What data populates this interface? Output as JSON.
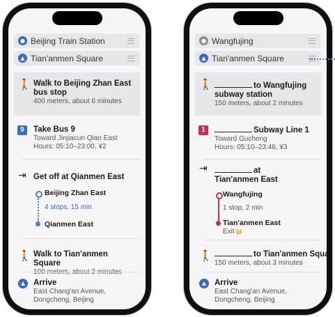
{
  "left": {
    "origin": "Beijing Train Station",
    "destination": "Tian'anmen Square",
    "steps": {
      "walk1_title": "Walk to Beijing Zhan East bus stop",
      "walk1_sub": "400 meters, about 6 minutes",
      "bus_number": "9",
      "bus_title": "Take Bus 9",
      "bus_toward": "Toward Jinjiacun Qiao East",
      "bus_hours": "Hours: 05:10–23:00, ¥2",
      "getoff_title": "Get off at Qianmen East",
      "stop_from": "Beijing Zhan East",
      "stop_info": "4 stops, 15 min",
      "stop_to": "Qianmen East",
      "walk2_title": "Walk to Tian'anmen Square",
      "walk2_sub": "100 meters, about 2 minutes",
      "arrive_title": "Arrive",
      "arrive_addr": "East Chang'an Avenue, Dongcheng, Beijing"
    }
  },
  "right": {
    "origin": "Wangfujing",
    "destination": "Tian'anmen Square",
    "steps": {
      "walk1_title": "to Wangfujing subway station",
      "walk1_sub": "150 meters, about 2 minutes",
      "line_number": "1",
      "line_title": "Subway Line 1",
      "line_toward": "Toward Gucheng",
      "line_hours": "Hours: 05:10–23:46, ¥3",
      "getoff_title_a": "at",
      "getoff_title_b": "Tian'anmen East",
      "stop_from": "Wangfujing",
      "stop_info": "1 stop, 2 min",
      "stop_to": "Tian'anmen East",
      "exit_label": "Exit",
      "exit_badge": "B",
      "walk2_title": "to Tian'anmen Square",
      "walk2_sub": "150 meters, about 3 minutes",
      "arrive_title": "Arrive",
      "arrive_addr": "East Chang'an Avenue, Dongcheng, Beijing"
    }
  },
  "icons": {
    "walk": "walking-person-icon",
    "exit": "exit-arrow-icon",
    "arrive": "destination-marker-icon"
  },
  "colors": {
    "blue_accent": "#3b67c6",
    "subway_red": "#c8304f",
    "exit_yellow": "#f2b632"
  }
}
